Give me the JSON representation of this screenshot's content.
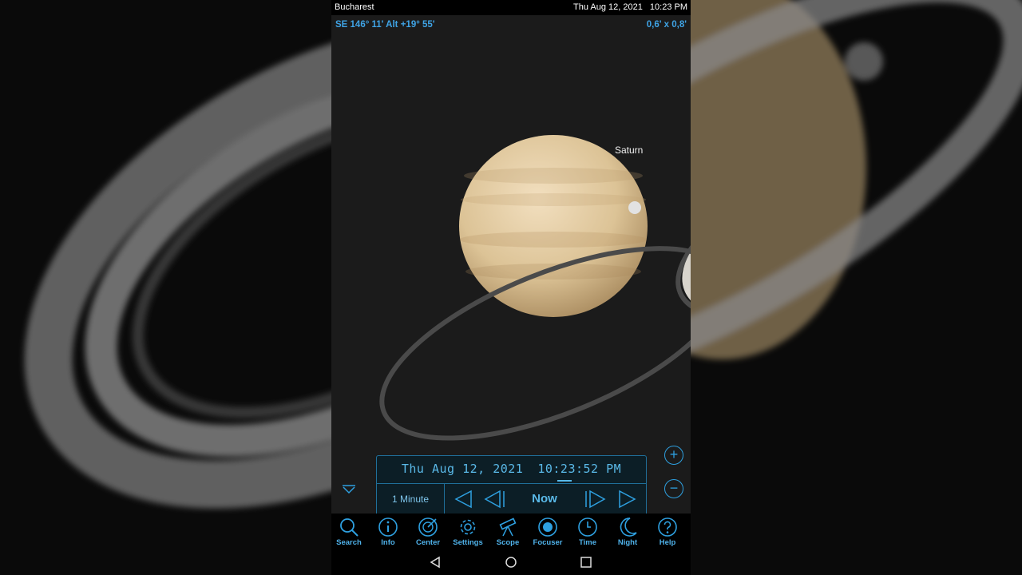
{
  "status_bar": {
    "location": "Bucharest",
    "date": "Thu Aug 12, 2021",
    "time": "10:23 PM"
  },
  "sky_view": {
    "coordinates": "SE 146° 11' Alt +19° 55'",
    "field_of_view": "0,6' x  0,8'",
    "object_label": "Saturn"
  },
  "zoom": {
    "in_symbol": "+",
    "out_symbol": "−"
  },
  "time_panel": {
    "date": "Thu Aug 12, 2021",
    "time": "10:23:52 PM",
    "step": "1 Minute",
    "now_label": "Now"
  },
  "toolbar": {
    "items": [
      {
        "label": "Search",
        "icon": "search-icon"
      },
      {
        "label": "Info",
        "icon": "info-icon"
      },
      {
        "label": "Center",
        "icon": "center-icon"
      },
      {
        "label": "Settings",
        "icon": "gear-icon"
      },
      {
        "label": "Scope",
        "icon": "telescope-icon"
      },
      {
        "label": "Focuser",
        "icon": "focuser-icon"
      },
      {
        "label": "Time",
        "icon": "clock-icon"
      },
      {
        "label": "Night",
        "icon": "moon-icon"
      },
      {
        "label": "Help",
        "icon": "help-icon"
      }
    ]
  },
  "colors": {
    "accent": "#3fa4e6",
    "panel_bg": "#0c1e26",
    "sky_bg": "#1b1b1b"
  }
}
